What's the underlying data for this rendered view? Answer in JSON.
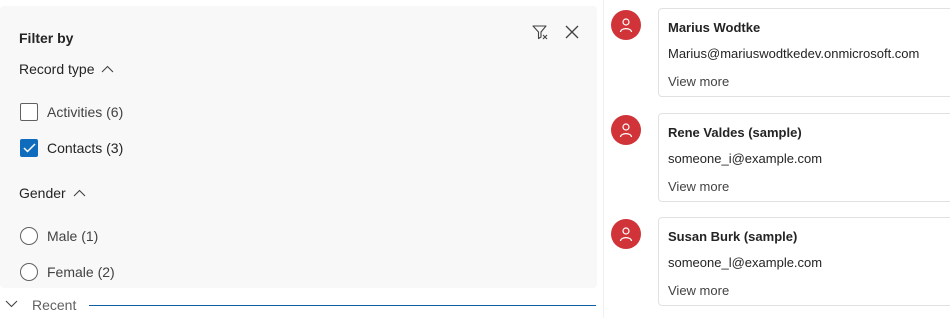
{
  "filter_panel": {
    "title": "Filter by",
    "icons": {
      "clear": "clear-filter-icon",
      "close": "close-icon"
    },
    "sections": [
      {
        "label": "Record type",
        "expanded": true,
        "control": "checkbox",
        "options": [
          {
            "label": "Activities (6)",
            "checked": false
          },
          {
            "label": "Contacts (3)",
            "checked": true
          }
        ]
      },
      {
        "label": "Gender",
        "expanded": true,
        "control": "radio",
        "options": [
          {
            "label": "Male (1)",
            "checked": false
          },
          {
            "label": "Female (2)",
            "checked": false
          }
        ]
      }
    ]
  },
  "recent": {
    "label": "Recent",
    "expanded": false
  },
  "results": [
    {
      "name": "Marius Wodtke",
      "email": "Marius@mariuswodtkedev.onmicrosoft.com",
      "more": "View more"
    },
    {
      "name": "Rene Valdes (sample)",
      "email": "someone_i@example.com",
      "more": "View more"
    },
    {
      "name": "Susan Burk (sample)",
      "email": "someone_l@example.com",
      "more": "View more"
    }
  ],
  "colors": {
    "accent": "#0f6cbd",
    "avatar": "#d13438",
    "panel_bg": "#f8f8f8",
    "recent_line": "#115ea3"
  }
}
